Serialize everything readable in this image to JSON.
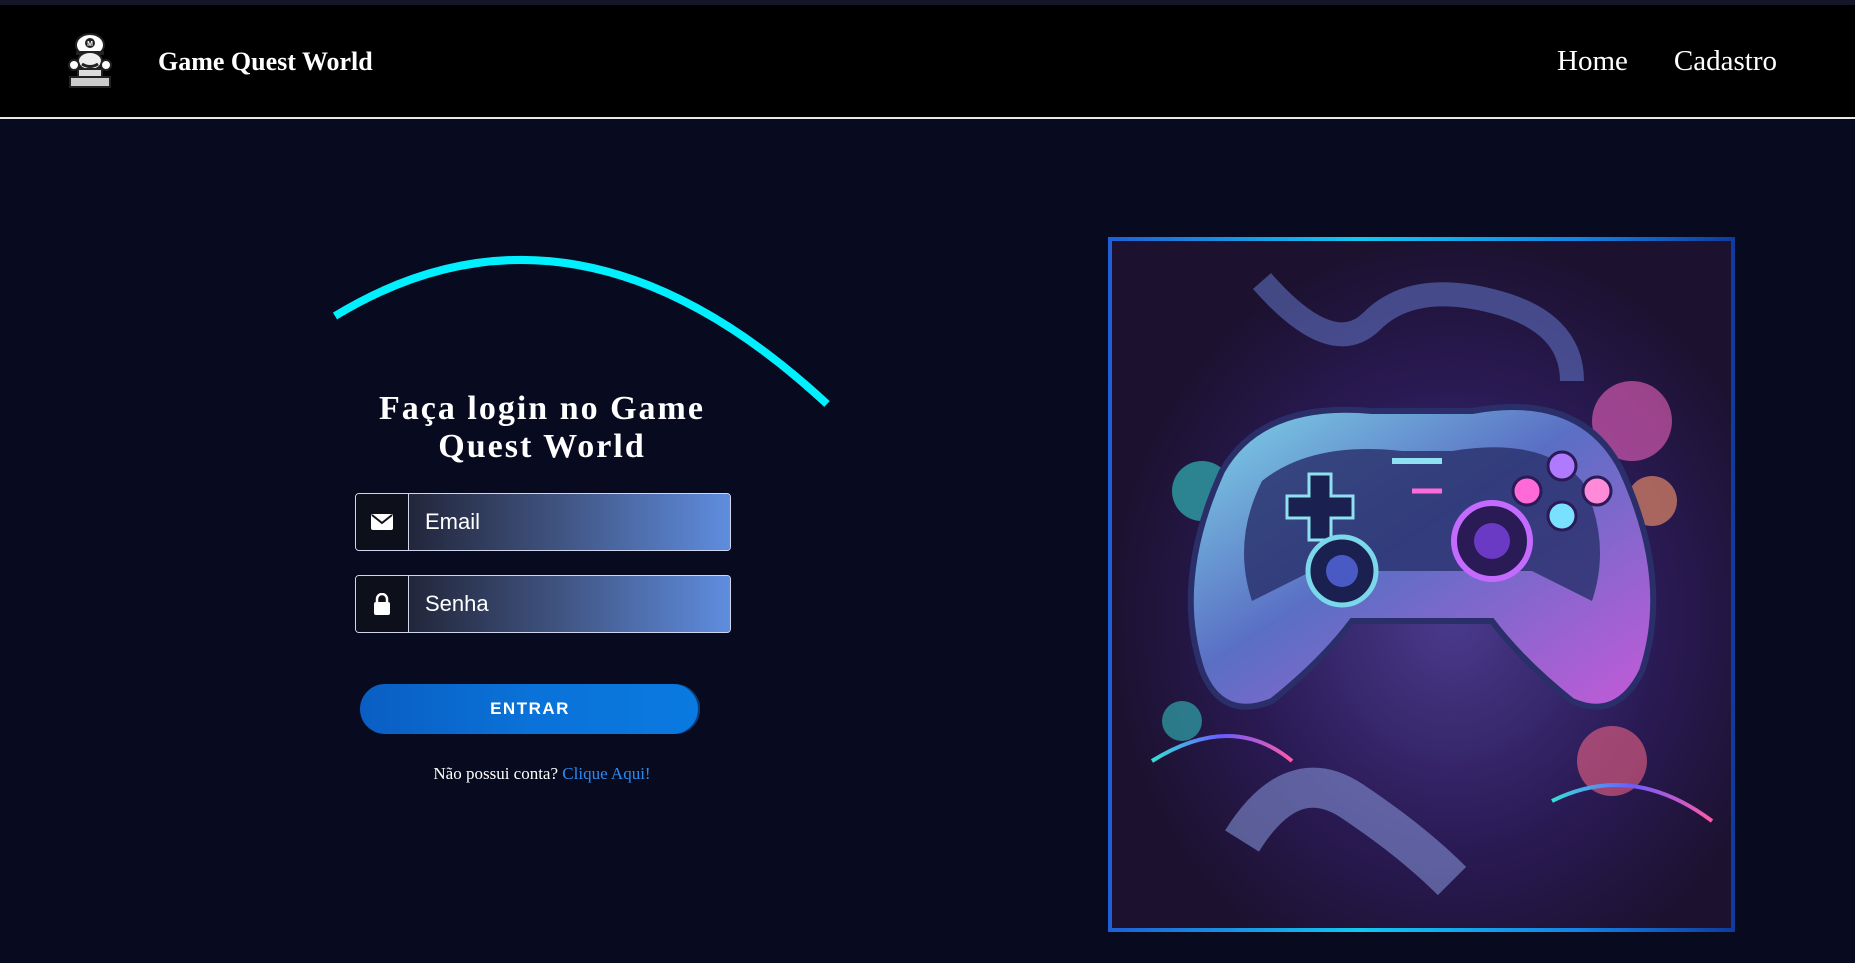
{
  "header": {
    "brand": "Game Quest World",
    "nav": [
      {
        "label": "Home"
      },
      {
        "label": "Cadastro"
      }
    ]
  },
  "login": {
    "title": "Faça login no Game Quest World",
    "email_placeholder": "Email",
    "password_placeholder": "Senha",
    "submit_label": "ENTRAR",
    "signup_prompt": "Não possui conta?",
    "signup_link": "Clique Aqui!"
  },
  "icons": {
    "logo": "mario-logo-icon",
    "email": "envelope-icon",
    "password": "lock-icon",
    "hero": "game-controller-artwork"
  },
  "colors": {
    "background": "#080a1f",
    "navbar": "#000000",
    "arc": "#00f0ff",
    "button": "#0a72d8",
    "link": "#2a8cf0"
  }
}
